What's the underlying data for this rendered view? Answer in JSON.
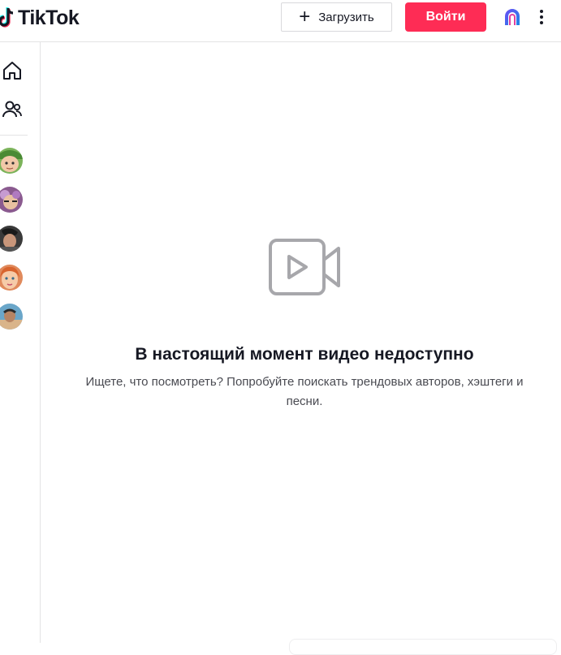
{
  "header": {
    "logo_text": "TikTok",
    "upload_label": "Загрузить",
    "login_label": "Войти"
  },
  "sidebar": {
    "nav_items": [
      {
        "icon": "home-icon"
      },
      {
        "icon": "following-icon"
      }
    ],
    "avatars": [
      {
        "icon": "avatar",
        "color": "#7bb35a"
      },
      {
        "icon": "avatar",
        "color": "#8a5a8f"
      },
      {
        "icon": "avatar",
        "color": "#3a3a3a"
      },
      {
        "icon": "avatar",
        "color": "#e08a5c"
      },
      {
        "icon": "avatar",
        "color": "#6aa6c9"
      }
    ]
  },
  "main": {
    "title": "В настоящий момент видео недоступно",
    "description": "Ищете, что посмотреть? Попробуйте поискать трендовых авторов, хэштеги и песни."
  },
  "colors": {
    "accent": "#fe2c55",
    "text": "#161823",
    "icon_gray": "#a7a7ab"
  }
}
